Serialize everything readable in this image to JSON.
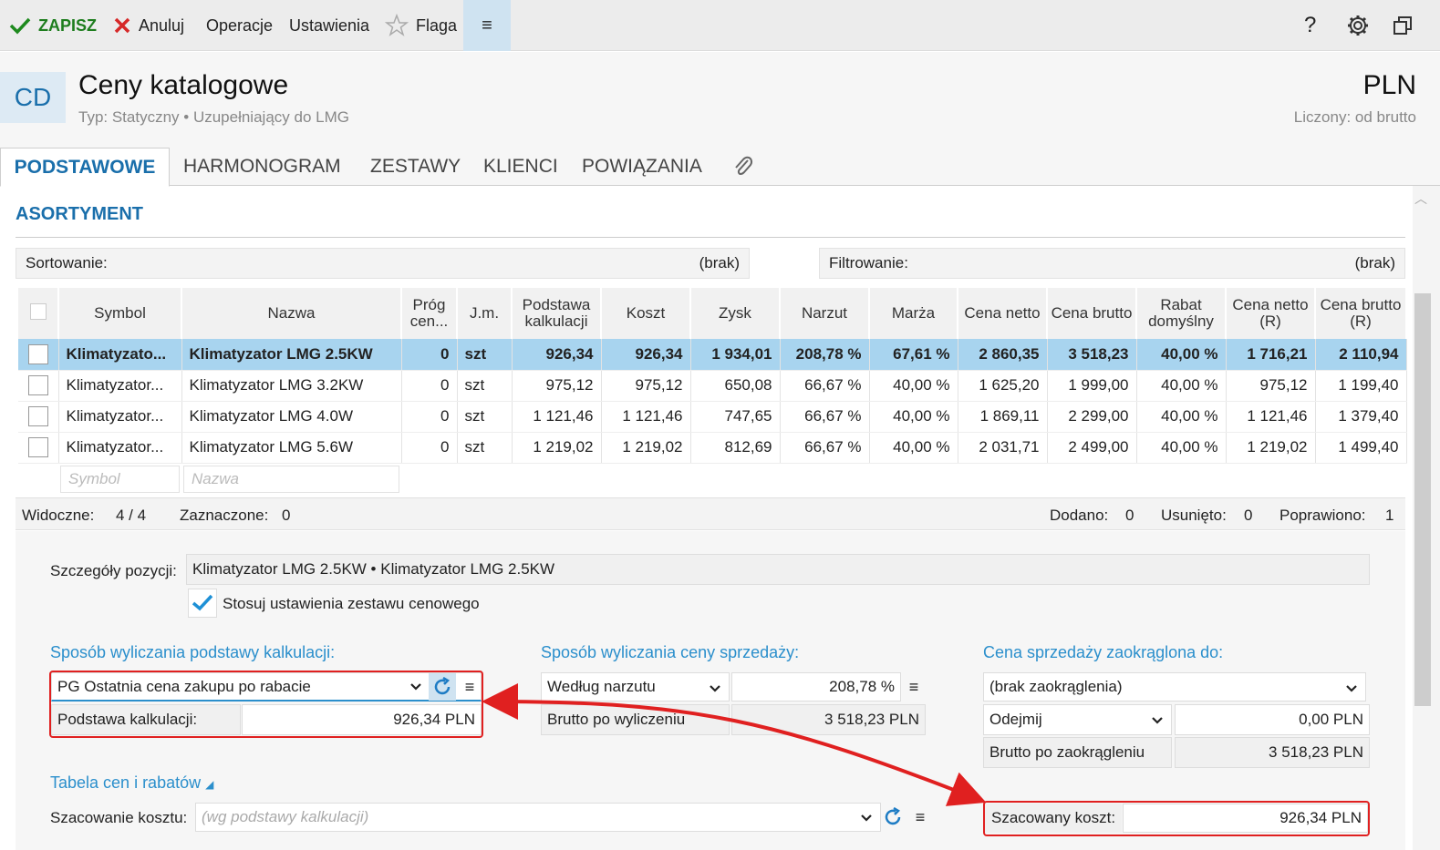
{
  "toolbar": {
    "save": "ZAPISZ",
    "cancel": "Anuluj",
    "operations": "Operacje",
    "settings": "Ustawienia",
    "flag": "Flaga",
    "menu": "≡",
    "help": "?"
  },
  "header": {
    "badge": "CD",
    "title": "Ceny katalogowe",
    "subtitle": "Typ: Statyczny • Uzupełniający do LMG",
    "currency": "PLN",
    "currency_sub": "Liczony: od brutto"
  },
  "tabs": [
    "PODSTAWOWE",
    "HARMONOGRAM",
    "ZESTAWY",
    "KLIENCI",
    "POWIĄZANIA"
  ],
  "section": {
    "title": "ASORTYMENT"
  },
  "sort": {
    "label": "Sortowanie:",
    "value": "(brak)"
  },
  "filter": {
    "label": "Filtrowanie:",
    "value": "(brak)"
  },
  "table": {
    "headers": [
      "Symbol",
      "Nazwa",
      "Próg cen...",
      "J.m.",
      "Podstawa kalkulacji",
      "Koszt",
      "Zysk",
      "Narzut",
      "Marża",
      "Cena netto",
      "Cena brutto",
      "Rabat domyślny",
      "Cena netto (R)",
      "Cena brutto (R)"
    ],
    "rows": [
      [
        "Klimatyzato...",
        "Klimatyzator LMG 2.5KW",
        "0",
        "szt",
        "926,34",
        "926,34",
        "1 934,01",
        "208,78 %",
        "67,61 %",
        "2 860,35",
        "3 518,23",
        "40,00 %",
        "1 716,21",
        "2 110,94"
      ],
      [
        "Klimatyzator...",
        "Klimatyzator LMG 3.2KW",
        "0",
        "szt",
        "975,12",
        "975,12",
        "650,08",
        "66,67 %",
        "40,00 %",
        "1 625,20",
        "1 999,00",
        "40,00 %",
        "975,12",
        "1 199,40"
      ],
      [
        "Klimatyzator...",
        "Klimatyzator LMG 4.0W",
        "0",
        "szt",
        "1 121,46",
        "1 121,46",
        "747,65",
        "66,67 %",
        "40,00 %",
        "1 869,11",
        "2 299,00",
        "40,00 %",
        "1 121,46",
        "1 379,40"
      ],
      [
        "Klimatyzator...",
        "Klimatyzator LMG 5.6W",
        "0",
        "szt",
        "1 219,02",
        "1 219,02",
        "812,69",
        "66,67 %",
        "40,00 %",
        "2 031,71",
        "2 499,00",
        "40,00 %",
        "1 219,02",
        "1 499,40"
      ]
    ],
    "filter_placeholders": {
      "symbol": "Symbol",
      "name": "Nazwa"
    }
  },
  "status": {
    "visible_label": "Widoczne:",
    "visible_value": "4 /  4",
    "selected_label": "Zaznaczone:",
    "selected_value": "0",
    "added_label": "Dodano:",
    "added_value": "0",
    "removed_label": "Usunięto:",
    "removed_value": "0",
    "fixed_label": "Poprawiono:",
    "fixed_value": "1"
  },
  "details": {
    "position_label": "Szczegóły pozycji:",
    "position_value": "Klimatyzator LMG 2.5KW   •   Klimatyzator LMG 2.5KW",
    "use_set_label": "Stosuj ustawienia zestawu cenowego",
    "calc_base_title": "Sposób wyliczania podstawy kalkulacji:",
    "calc_base_select": "PG  Ostatnia cena zakupu po rabacie",
    "calc_base_label": "Podstawa kalkulacji:",
    "calc_base_value": "926,34 PLN",
    "sale_title": "Sposób wyliczania ceny sprzedaży:",
    "sale_select": "Według narzutu",
    "sale_value": "208,78 %",
    "gross_label": "Brutto po wyliczeniu",
    "gross_value": "3 518,23 PLN",
    "round_title": "Cena sprzedaży zaokrąglona do:",
    "round_select": "(brak zaokrąglenia)",
    "subtract_select": "Odejmij",
    "subtract_value": "0,00 PLN",
    "gross_round_label": "Brutto po zaokrągleniu",
    "gross_round_value": "3 518,23 PLN",
    "prices_link": "Tabela cen i rabatów",
    "cost_est_label": "Szacowanie kosztu:",
    "cost_est_placeholder": "(wg podstawy kalkulacji)",
    "est_cost_label": "Szacowany koszt:",
    "est_cost_value": "926,34 PLN"
  },
  "colors": {
    "accent": "#1a6fab",
    "link": "#2b8fcc",
    "highlight": "#e02020",
    "selected_row": "#a8d4ef"
  }
}
